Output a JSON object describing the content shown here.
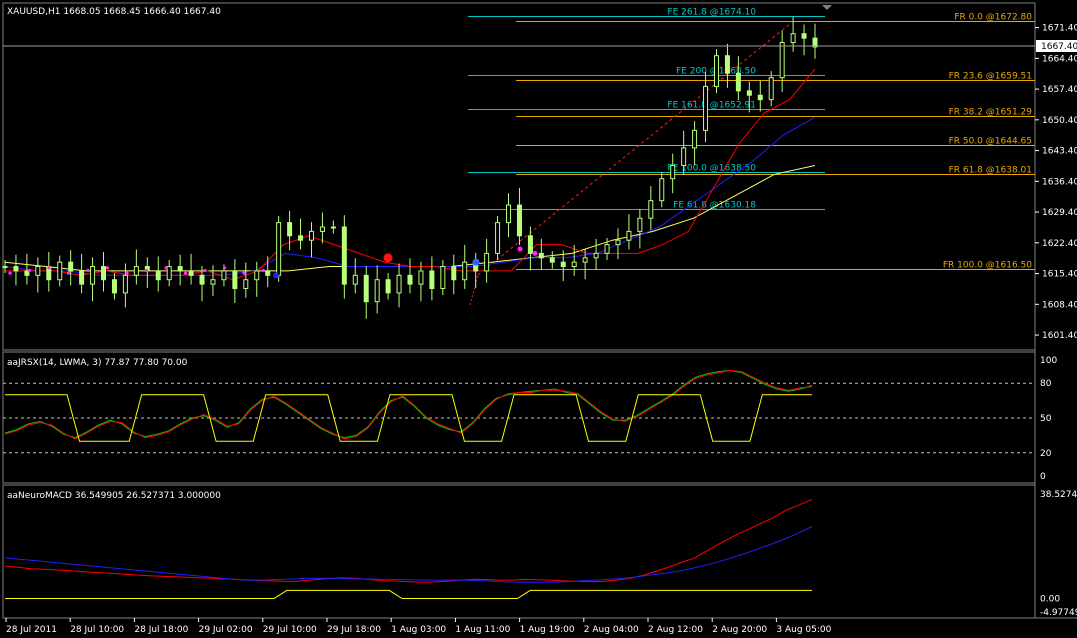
{
  "main": {
    "header": "XAUUSD,H1  1668.05 1668.45 1666.40 1667.40",
    "price_ticks": [
      "1671.40",
      "1664.40",
      "1657.40",
      "1650.40",
      "1643.40",
      "1636.40",
      "1629.40",
      "1622.40",
      "1615.40",
      "1608.40",
      "1601.40"
    ],
    "current_price": "1667.40",
    "fib_levels": [
      {
        "label": "FE 261.8 @1674.10",
        "price": 1674.1,
        "type": "FE"
      },
      {
        "label": "FR 0.0 @1672.80",
        "price": 1672.8,
        "type": "FR"
      },
      {
        "label": "FE 200 @1660.50",
        "price": 1660.5,
        "type": "FE"
      },
      {
        "label": "FR 23.6 @1659.51",
        "price": 1659.51,
        "type": "FR"
      },
      {
        "label": "FE 161.8 @1652.91",
        "price": 1652.91,
        "type": "FE"
      },
      {
        "label": "FR 38.2 @1651.29",
        "price": 1651.29,
        "type": "FR"
      },
      {
        "label": "FR 50.0 @1644.65",
        "price": 1644.65,
        "type": "FR"
      },
      {
        "label": "FE 100.0 @1638.50",
        "price": 1638.5,
        "type": "FE"
      },
      {
        "label": "FR 61.8 @1638.01",
        "price": 1638.01,
        "type": "FR"
      },
      {
        "label": "FE 61.8 @1630.18",
        "price": 1630.18,
        "type": "FE"
      },
      {
        "label": "FR 100.0 @1616.50",
        "price": 1616.5,
        "type": "FR"
      }
    ]
  },
  "rsx": {
    "header": "aaJRSX(14, LWMA, 3)  77.87 77.80 70.00",
    "ticks": [
      "100",
      "80",
      "50",
      "20",
      "0"
    ]
  },
  "macd": {
    "header": "aaNeuroMACD 36.549905 26.527371 3.000000",
    "ticks": [
      "38.52742",
      "0.00",
      "-4.97749"
    ]
  },
  "time_axis": [
    "28 Jul 2011",
    "28 Jul 10:00",
    "28 Jul 18:00",
    "29 Jul 02:00",
    "29 Jul 10:00",
    "29 Jul 18:00",
    "1 Aug 03:00",
    "1 Aug 11:00",
    "1 Aug 19:00",
    "2 Aug 04:00",
    "2 Aug 12:00",
    "2 Aug 20:00",
    "3 Aug 05:00"
  ],
  "colors": {
    "fe": "#00c8c8",
    "fr": "#e8a800",
    "candle": "#b8ff7a",
    "ma_red": "#ff0000",
    "ma_blue": "#2020ff",
    "ma_yellow": "#ffff66",
    "sig_green": "#00c800",
    "step": "#ffff00",
    "axis": "#ffffff"
  },
  "chart_data": [
    {
      "type": "candlestick",
      "title": "XAUUSD,H1",
      "ylim": [
        1598,
        1677
      ],
      "current_price": 1667.4,
      "x_tick_labels": [
        "28 Jul 2011",
        "28 Jul 10:00",
        "28 Jul 18:00",
        "29 Jul 02:00",
        "29 Jul 10:00",
        "29 Jul 18:00",
        "1 Aug 03:00",
        "1 Aug 11:00",
        "1 Aug 19:00",
        "2 Aug 04:00",
        "2 Aug 12:00",
        "2 Aug 20:00",
        "3 Aug 05:00"
      ],
      "close_path": [
        1617,
        1616,
        1615,
        1617,
        1614,
        1618,
        1616,
        1613,
        1617,
        1614,
        1611,
        1615,
        1617,
        1616,
        1614,
        1617,
        1616,
        1615,
        1613,
        1614,
        1616,
        1612,
        1614,
        1616,
        1615,
        1627,
        1624,
        1623,
        1625,
        1626,
        1626,
        1613,
        1615,
        1609,
        1614,
        1611,
        1615,
        1613,
        1616,
        1612,
        1617,
        1614,
        1618,
        1616,
        1620,
        1627,
        1631,
        1624,
        1620,
        1619,
        1618,
        1617,
        1618,
        1619,
        1620,
        1622,
        1623,
        1625,
        1628,
        1632,
        1637,
        1640,
        1644,
        1648,
        1658,
        1665,
        1661,
        1657,
        1656,
        1655,
        1660,
        1668,
        1670,
        1669,
        1667
      ],
      "ma_red": [
        1616,
        1616,
        1616,
        1615,
        1616,
        1615,
        1615,
        1615,
        1616,
        1614,
        1616,
        1622,
        1624,
        1622,
        1620,
        1618,
        1617,
        1617,
        1616,
        1616,
        1616,
        1622,
        1622,
        1620,
        1620,
        1620,
        1622,
        1625,
        1635,
        1645,
        1652,
        1655,
        1662
      ],
      "ma_blue": [
        1617,
        1616,
        1616,
        1615,
        1615,
        1615,
        1615,
        1615,
        1616,
        1620,
        1619,
        1617,
        1617,
        1617,
        1617,
        1617,
        1618,
        1619,
        1619,
        1620,
        1623,
        1626,
        1631,
        1636,
        1641,
        1647,
        1651
      ],
      "ma_yellow": [
        1618,
        1617,
        1616,
        1616,
        1616,
        1616,
        1616,
        1616,
        1617,
        1617,
        1617,
        1617,
        1618,
        1619,
        1620,
        1623,
        1625,
        1628,
        1633,
        1638,
        1640
      ]
    },
    {
      "type": "line",
      "title": "aaJRSX(14, LWMA, 3)",
      "ylim": [
        0,
        100
      ],
      "series": [
        {
          "name": "aaJRSX(14, LWMA, 3)",
          "values": [
            37,
            40,
            45,
            47,
            43,
            36,
            33,
            38,
            44,
            48,
            45,
            37,
            34,
            36,
            39,
            45,
            50,
            52,
            48,
            42,
            46,
            58,
            66,
            68,
            62,
            55,
            48,
            41,
            36,
            33,
            35,
            42,
            55,
            65,
            68,
            60,
            50,
            44,
            40,
            38,
            46,
            58,
            67,
            70,
            72,
            73,
            74,
            75,
            72,
            70,
            62,
            54,
            48,
            48,
            52,
            58,
            64,
            70,
            78,
            85,
            88,
            90,
            91,
            89,
            84,
            79,
            75,
            73,
            75,
            78
          ]
        },
        {
          "name": "aaJRSX(14, LWMA, 3)",
          "values": [
            36,
            39,
            44,
            46,
            44,
            37,
            32,
            37,
            43,
            47,
            46,
            38,
            33,
            35,
            38,
            44,
            49,
            53,
            49,
            43,
            45,
            57,
            65,
            69,
            63,
            56,
            49,
            42,
            37,
            32,
            34,
            41,
            54,
            64,
            69,
            61,
            51,
            45,
            41,
            37,
            45,
            57,
            66,
            71,
            72,
            72,
            74,
            74,
            73,
            71,
            63,
            55,
            49,
            47,
            51,
            57,
            63,
            69,
            77,
            84,
            87,
            89,
            91,
            90,
            85,
            80,
            76,
            74,
            76,
            77
          ]
        },
        {
          "name": "step",
          "values": [
            70,
            70,
            70,
            70,
            70,
            70,
            30,
            30,
            30,
            30,
            30,
            70,
            70,
            70,
            70,
            70,
            70,
            30,
            30,
            30,
            30,
            70,
            70,
            70,
            70,
            70,
            70,
            30,
            30,
            30,
            30,
            70,
            70,
            70,
            70,
            70,
            70,
            30,
            30,
            30,
            30,
            70,
            70,
            70,
            70,
            70,
            70,
            30,
            30,
            30,
            30,
            70,
            70,
            70,
            70,
            70,
            70,
            30,
            30,
            30,
            30,
            70,
            70,
            70,
            70,
            70
          ]
        }
      ],
      "grid_levels": [
        80,
        50,
        20
      ]
    },
    {
      "type": "line",
      "title": "aaNeuroMACD",
      "ylim": [
        -4.97749,
        38.52742
      ],
      "series": [
        {
          "name": "aaNeuroMACD",
          "values": [
            12,
            11.5,
            11,
            10.8,
            10.5,
            10.2,
            9.9,
            9.6,
            9.3,
            9,
            8.7,
            8.4,
            8.2,
            8,
            7.8,
            7.6,
            7.4,
            7.2,
            7,
            6.8,
            6.6,
            6.4,
            6.2,
            6.6,
            7,
            7.4,
            7.6,
            7.4,
            7,
            6.6,
            6.4,
            6.2,
            6,
            6.1,
            6.4,
            6.8,
            7.1,
            7,
            6.8,
            6.8,
            7,
            6.9,
            6.7,
            6.5,
            6.3,
            6.2,
            6.3,
            6.8,
            7.5,
            8.5,
            10,
            11.6,
            13.3,
            15,
            17.8,
            20.5,
            23,
            25.3,
            27.5,
            29.8,
            32.5,
            34.5,
            36.55
          ]
        },
        {
          "name": "aaNeuroMACD",
          "values": [
            15,
            14.5,
            14,
            13.5,
            13,
            12.5,
            12,
            11.5,
            11,
            10.5,
            10,
            9.5,
            9,
            8.5,
            8,
            7.5,
            7,
            6.8,
            6.8,
            7,
            7.2,
            7.4,
            7.5,
            7.4,
            7.3,
            7.2,
            7.1,
            7,
            6.9,
            6.8,
            6.8,
            6.8,
            6.8,
            6.6,
            6.3,
            6.1,
            6,
            6,
            6,
            6.2,
            6.5,
            6.8,
            7.1,
            7.5,
            8.1,
            8.8,
            9.5,
            10.3,
            11.5,
            12.8,
            14.3,
            16,
            17.8,
            19.7,
            21.7,
            24,
            26.53
          ]
        },
        {
          "name": "step",
          "values": [
            0,
            0,
            0,
            0,
            0,
            0,
            0,
            0,
            0,
            0,
            0,
            0,
            0,
            0,
            0,
            0,
            0,
            0,
            0,
            0,
            0,
            0,
            3,
            3,
            3,
            3,
            3,
            3,
            3,
            3,
            3,
            0,
            0,
            0,
            0,
            0,
            0,
            0,
            0,
            0,
            0,
            3,
            3,
            3,
            3,
            3,
            3,
            3,
            3,
            3,
            3,
            3,
            3,
            3,
            3,
            3,
            3,
            3,
            3,
            3,
            3,
            3,
            3,
            3
          ]
        }
      ]
    }
  ]
}
